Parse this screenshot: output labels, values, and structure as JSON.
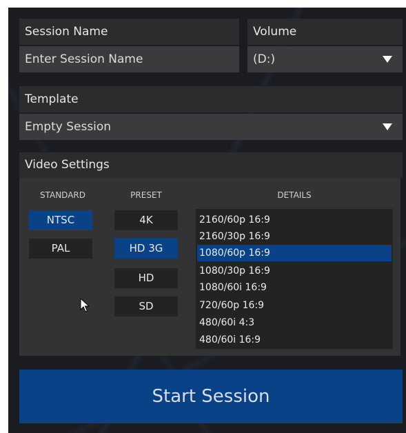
{
  "session": {
    "name_label": "Session Name",
    "name_placeholder": "Enter Session Name",
    "volume_label": "Volume",
    "volume_value": "(D:)"
  },
  "template": {
    "label": "Template",
    "value": "Empty Session"
  },
  "video": {
    "label": "Video Settings",
    "standard_header": "STANDARD",
    "preset_header": "PRESET",
    "details_header": "DETAILS",
    "standards": [
      {
        "label": "NTSC",
        "selected": true
      },
      {
        "label": "PAL",
        "selected": false
      }
    ],
    "presets": [
      {
        "label": "4K",
        "selected": false
      },
      {
        "label": "HD 3G",
        "selected": true
      },
      {
        "label": "HD",
        "selected": false
      },
      {
        "label": "SD",
        "selected": false
      }
    ],
    "details": [
      "2160/60p 16:9",
      "2160/30p 16:9",
      "1080/60p 16:9",
      "1080/30p 16:9",
      "1080/60i 16:9",
      "720/60p 16:9",
      "480/60i 4:3",
      "480/60i 16:9"
    ],
    "details_selected_index": 2
  },
  "start_button": "Start Session",
  "colors": {
    "accent": "#0a4287",
    "background": "#1a1c22",
    "panel": "#333335",
    "field": "#3b3b3d"
  },
  "icons": {
    "dropdown": "triangle-down-icon",
    "cursor": "mouse-pointer-icon"
  }
}
